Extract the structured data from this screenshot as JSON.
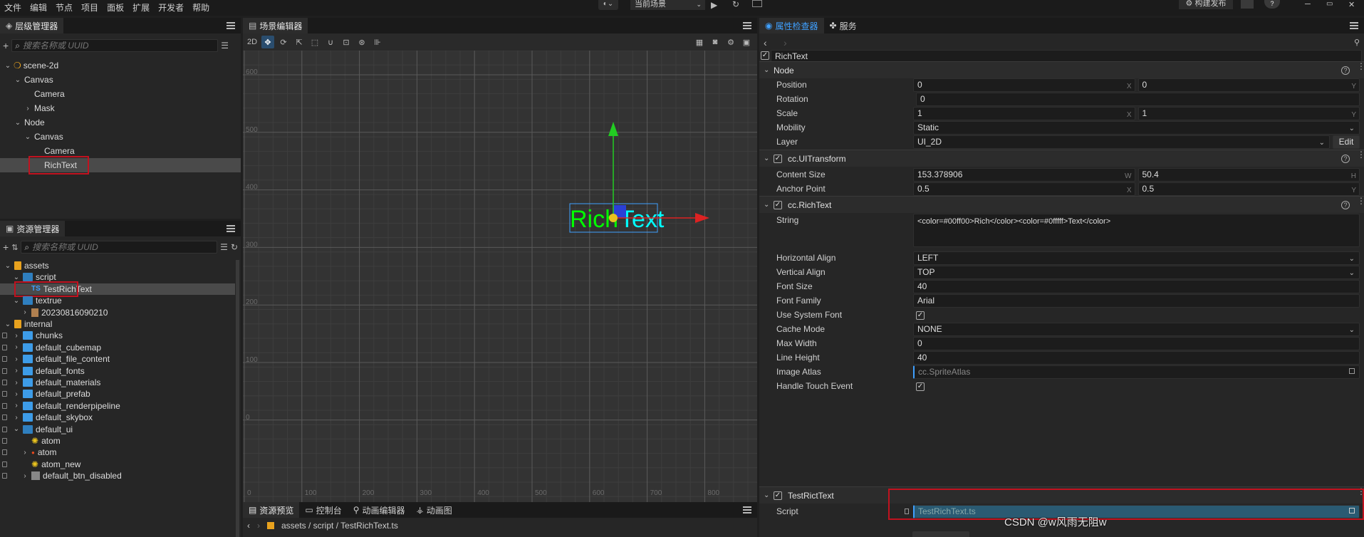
{
  "menu": [
    "文件",
    "编辑",
    "节点",
    "项目",
    "面板",
    "扩展",
    "开发者",
    "帮助"
  ],
  "topbar": {
    "scene_select": "当前场景",
    "build_label": "构建发布"
  },
  "hierarchy": {
    "tab": "层级管理器",
    "search_placeholder": "搜索名称或 UUID",
    "nodes": [
      {
        "label": "scene-2d",
        "depth": 0,
        "chev": "v"
      },
      {
        "label": "Canvas",
        "depth": 1,
        "chev": "v"
      },
      {
        "label": "Camera",
        "depth": 2,
        "chev": ""
      },
      {
        "label": "Mask",
        "depth": 2,
        "chev": ">"
      },
      {
        "label": "Node",
        "depth": 1,
        "chev": "v"
      },
      {
        "label": "Canvas",
        "depth": 2,
        "chev": "v"
      },
      {
        "label": "Camera",
        "depth": 3,
        "chev": ""
      },
      {
        "label": "RichText",
        "depth": 3,
        "chev": "",
        "selected": true
      }
    ]
  },
  "assets": {
    "tab": "资源管理器",
    "search_placeholder": "搜索名称或 UUID",
    "items": [
      {
        "label": "assets",
        "depth": 0,
        "chev": "v",
        "icon": "db"
      },
      {
        "label": "script",
        "depth": 1,
        "chev": "v",
        "icon": "folderOpen"
      },
      {
        "label": "TestRichText",
        "depth": 2,
        "chev": "",
        "icon": "ts",
        "selected": true
      },
      {
        "label": "textrue",
        "depth": 1,
        "chev": "v",
        "icon": "folderOpen"
      },
      {
        "label": "20230816090210",
        "depth": 2,
        "chev": ">",
        "icon": "image"
      },
      {
        "label": "internal",
        "depth": 0,
        "chev": "v",
        "icon": "db"
      },
      {
        "label": "chunks",
        "depth": 1,
        "chev": ">",
        "icon": "folder",
        "lock": true
      },
      {
        "label": "default_cubemap",
        "depth": 1,
        "chev": ">",
        "icon": "folder",
        "lock": true
      },
      {
        "label": "default_file_content",
        "depth": 1,
        "chev": ">",
        "icon": "folder",
        "lock": true
      },
      {
        "label": "default_fonts",
        "depth": 1,
        "chev": ">",
        "icon": "folder",
        "lock": true
      },
      {
        "label": "default_materials",
        "depth": 1,
        "chev": ">",
        "icon": "folder",
        "lock": true
      },
      {
        "label": "default_prefab",
        "depth": 1,
        "chev": ">",
        "icon": "folder",
        "lock": true
      },
      {
        "label": "default_renderpipeline",
        "depth": 1,
        "chev": ">",
        "icon": "folder",
        "lock": true
      },
      {
        "label": "default_skybox",
        "depth": 1,
        "chev": ">",
        "icon": "folder",
        "lock": true
      },
      {
        "label": "default_ui",
        "depth": 1,
        "chev": "v",
        "icon": "folderOpen",
        "lock": true
      },
      {
        "label": "atom",
        "depth": 2,
        "chev": "",
        "icon": "sparkle",
        "lock": true
      },
      {
        "label": "atom",
        "depth": 2,
        "chev": ">",
        "icon": "dot",
        "lock": true
      },
      {
        "label": "atom_new",
        "depth": 2,
        "chev": "",
        "icon": "sparkle",
        "lock": true
      },
      {
        "label": "default_btn_disabled",
        "depth": 2,
        "chev": ">",
        "icon": "gray",
        "lock": true
      }
    ]
  },
  "scene": {
    "tab": "场景编辑器",
    "mode": "2D",
    "y_ticks": [
      "600",
      "500",
      "400",
      "300",
      "200",
      "100",
      "0"
    ],
    "x_ticks": [
      "0",
      "100",
      "200",
      "300",
      "400",
      "500",
      "600",
      "700",
      "800"
    ],
    "rich_text": {
      "part1": "Rich",
      "part2": "Text",
      "color1": "#00ff00",
      "color2": "#00ffff"
    }
  },
  "bottom": {
    "tabs": [
      "资源预览",
      "控制台",
      "动画编辑器",
      "动画图"
    ],
    "path": "assets / script / TestRichText.ts"
  },
  "inspector": {
    "tabs": [
      "属性检查器",
      "服务"
    ],
    "node_name": "RichText",
    "node_section": "Node",
    "position": {
      "label": "Position",
      "x": "0",
      "y": "0"
    },
    "rotation": {
      "label": "Rotation",
      "v": "0"
    },
    "scale": {
      "label": "Scale",
      "x": "1",
      "y": "1"
    },
    "mobility": {
      "label": "Mobility",
      "v": "Static"
    },
    "layer": {
      "label": "Layer",
      "v": "UI_2D",
      "edit": "Edit"
    },
    "uitransform": "cc.UITransform",
    "content_size": {
      "label": "Content Size",
      "w": "153.378906",
      "h": "50.4"
    },
    "anchor": {
      "label": "Anchor Point",
      "x": "0.5",
      "y": "0.5"
    },
    "richtext_section": "cc.RichText",
    "string": {
      "label": "String",
      "v": "<color=#00ff00>Rich</color><color=#0fffff>Text</color>"
    },
    "halign": {
      "label": "Horizontal Align",
      "v": "LEFT"
    },
    "valign": {
      "label": "Vertical Align",
      "v": "TOP"
    },
    "font_size": {
      "label": "Font Size",
      "v": "40"
    },
    "font_family": {
      "label": "Font Family",
      "v": "Arial"
    },
    "use_system_font": {
      "label": "Use System Font",
      "v": "✓"
    },
    "cache_mode": {
      "label": "Cache Mode",
      "v": "NONE"
    },
    "max_width": {
      "label": "Max Width",
      "v": "0"
    },
    "line_height": {
      "label": "Line Height",
      "v": "40"
    },
    "image_atlas": {
      "label": "Image Atlas",
      "v": "cc.SpriteAtlas"
    },
    "handle_touch": {
      "label": "Handle Touch Event",
      "v": "✓"
    },
    "script_section": "TestRictText",
    "script": {
      "label": "Script",
      "v": "TestRichText.ts"
    }
  },
  "watermark": "CSDN @w风雨无阻w",
  "colors": {
    "accent": "#3fa0ff",
    "highlight": "#c1121f"
  }
}
